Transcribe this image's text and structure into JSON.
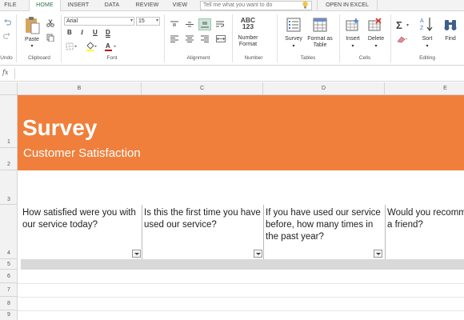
{
  "tabs": [
    "FILE",
    "HOME",
    "INSERT",
    "DATA",
    "REVIEW",
    "VIEW"
  ],
  "active_tab": "HOME",
  "tell_me_placeholder": "Tell me what you want to do",
  "open_in_excel": "OPEN IN EXCEL",
  "ribbon": {
    "undo_group": "Undo",
    "paste_label": "Paste",
    "clipboard_group": "Clipboard",
    "font_name": "Arial",
    "font_size": "15",
    "bold": "B",
    "italic": "I",
    "underline": "U",
    "double_underline": "D",
    "font_group": "Font",
    "alignment_group": "Alignment",
    "number_format_label": "Number Format",
    "number_icon_text": "ABC 123",
    "number_group": "Number",
    "survey_label": "Survey",
    "format_table_label": "Format as Table",
    "tables_group": "Tables",
    "insert_label": "Insert",
    "delete_label": "Delete",
    "cells_group": "Cells",
    "sort_label": "Sort",
    "find_label": "Find",
    "editing_group": "Editing"
  },
  "formula_bar": {
    "fx": "fx",
    "value": ""
  },
  "columns": [
    "B",
    "C",
    "D",
    "E"
  ],
  "rows": [
    "1",
    "2",
    "3",
    "4",
    "5",
    "6",
    "7",
    "8",
    "9"
  ],
  "sheet": {
    "title": "Survey",
    "subtitle": "Customer Satisfaction",
    "questions": [
      "How satisfied were you with our service today?",
      "Is this the first time you have used our service?",
      "If you have used our service before, how many times in the past year?",
      "Would you recommend us to a friend?"
    ]
  },
  "colors": {
    "banner": "#f07f3c",
    "accent": "#217346",
    "band": "#d9d9d9"
  }
}
